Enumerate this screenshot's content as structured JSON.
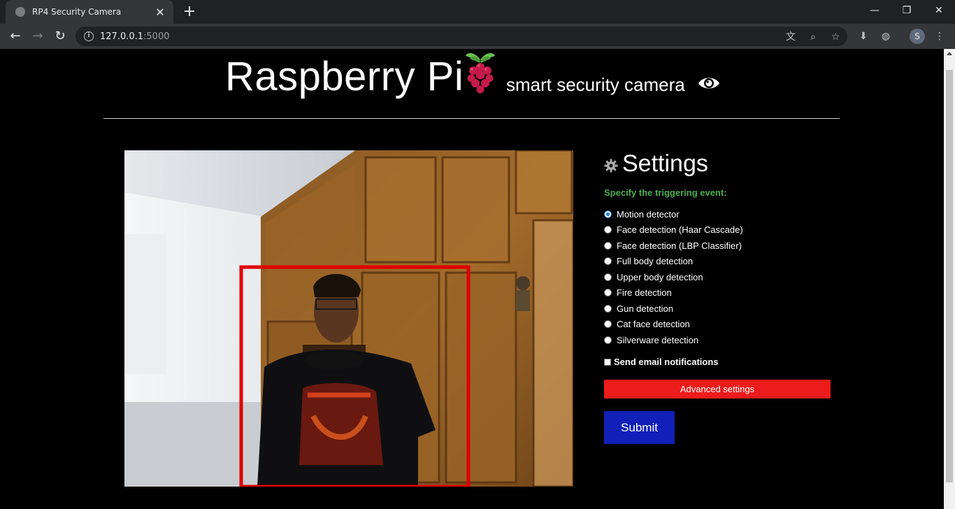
{
  "browser": {
    "tab_title": "RP4 Security Camera",
    "url_host": "127.0.0.1",
    "url_port": ":5000",
    "profile_initial": "S"
  },
  "header": {
    "brand": "Raspberry Pi",
    "subtitle": "smart security camera"
  },
  "settings": {
    "title": "Settings",
    "trigger_label": "Specify the triggering event:",
    "options": [
      {
        "label": "Motion detector",
        "checked": true
      },
      {
        "label": "Face detection (Haar Cascade)",
        "checked": false
      },
      {
        "label": "Face detection (LBP Classifier)",
        "checked": false
      },
      {
        "label": "Full body detection",
        "checked": false
      },
      {
        "label": "Upper body detection",
        "checked": false
      },
      {
        "label": "Fire detection",
        "checked": false
      },
      {
        "label": "Gun detection",
        "checked": false
      },
      {
        "label": "Cat face detection",
        "checked": false
      },
      {
        "label": "Silverware detection",
        "checked": false
      }
    ],
    "email_label": "Send email notifications",
    "email_checked": false,
    "advanced_label": "Advanced settings",
    "submit_label": "Submit"
  },
  "colors": {
    "accent_green": "#4caf50",
    "advanced_red": "#ed1c1c",
    "submit_blue": "#1020b8",
    "detection_box": "#e00000"
  },
  "icons": {
    "logo": "raspberry-icon",
    "subtitle": "eye-icon",
    "settings": "gear-icon"
  }
}
